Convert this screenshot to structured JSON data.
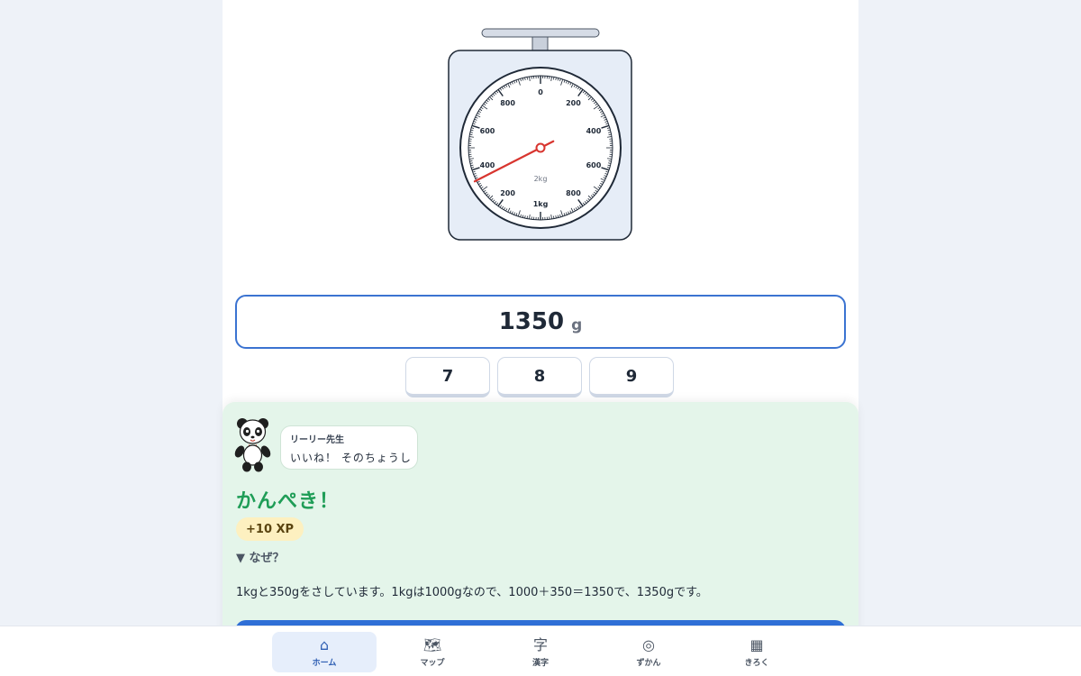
{
  "scale": {
    "dial_labels_right": [
      "0",
      "200",
      "400",
      "600",
      "800",
      "1kg"
    ],
    "dial_labels_left": [
      "200",
      "400",
      "600",
      "800"
    ],
    "center_label": "2kg",
    "pointer_value_g": 1350,
    "pointer_color": "#d8352f"
  },
  "answer": {
    "value": "1350",
    "unit": "g"
  },
  "keypad": {
    "keys": [
      "7",
      "8",
      "9"
    ]
  },
  "feedback": {
    "speaker": "リーリー先生",
    "speech": "いいね！ そのちょうし",
    "result": "かんぺき！",
    "xp": "+10 XP",
    "why_toggle": "▼ なぜ？",
    "explanation": "1kgと350gをさしています。1kgは1000gなので、1000＋350＝1350で、1350gです。",
    "accent_color": "#1f9d57"
  },
  "nav": {
    "items": [
      {
        "icon": "⌂",
        "label": "ホーム"
      },
      {
        "icon": "🗺",
        "label": "マップ"
      },
      {
        "icon": "字",
        "label": "漢字"
      },
      {
        "icon": "◎",
        "label": "ずかん"
      },
      {
        "icon": "▦",
        "label": "きろく"
      }
    ],
    "active_index": 0
  }
}
